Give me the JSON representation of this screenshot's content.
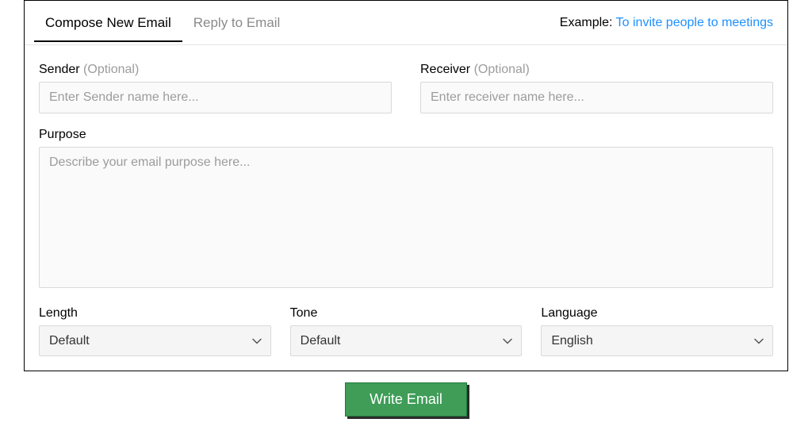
{
  "tabs": {
    "compose": "Compose New Email",
    "reply": "Reply to Email"
  },
  "example": {
    "label": "Example: ",
    "link": "To invite people to meetings"
  },
  "fields": {
    "sender": {
      "label": "Sender ",
      "optional": "(Optional)",
      "placeholder": "Enter Sender name here..."
    },
    "receiver": {
      "label": "Receiver ",
      "optional": "(Optional)",
      "placeholder": "Enter receiver name here..."
    },
    "purpose": {
      "label": "Purpose",
      "placeholder": "Describe your email purpose here..."
    },
    "length": {
      "label": "Length",
      "value": "Default"
    },
    "tone": {
      "label": "Tone",
      "value": "Default"
    },
    "language": {
      "label": "Language",
      "value": "English"
    }
  },
  "actions": {
    "write": "Write Email"
  }
}
